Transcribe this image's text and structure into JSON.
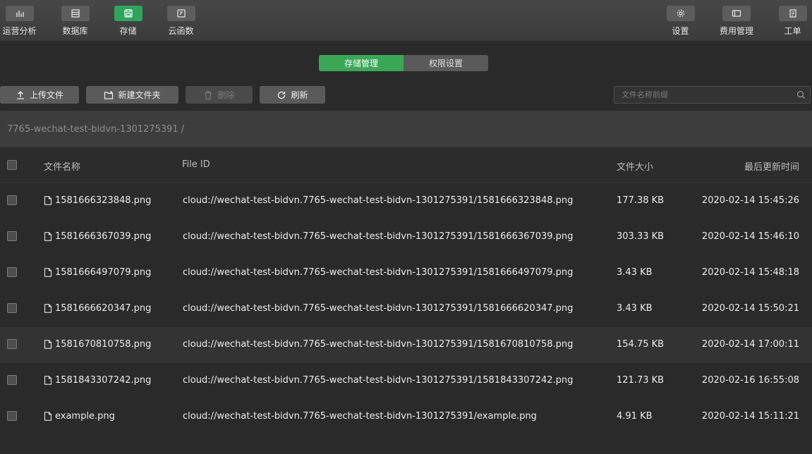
{
  "nav": {
    "left": [
      {
        "label": "运营分析",
        "icon": "bar-chart-icon"
      },
      {
        "label": "数据库",
        "icon": "database-icon"
      },
      {
        "label": "存储",
        "icon": "storage-icon",
        "active": true
      },
      {
        "label": "云函数",
        "icon": "cloud-function-icon"
      }
    ],
    "right": [
      {
        "label": "设置",
        "icon": "gear-icon"
      },
      {
        "label": "费用管理",
        "icon": "billing-icon"
      },
      {
        "label": "工单",
        "icon": "ticket-icon"
      }
    ]
  },
  "tabs": [
    {
      "label": "存储管理",
      "active": true
    },
    {
      "label": "权限设置",
      "active": false
    }
  ],
  "toolbar": {
    "upload": "上传文件",
    "new_folder": "新建文件夹",
    "delete": "删除",
    "refresh": "刷新"
  },
  "search": {
    "placeholder": "文件名称前缀",
    "value": ""
  },
  "path": "7765-wechat-test-bidvn-1301275391 /",
  "table": {
    "columns": [
      "文件名称",
      "File ID",
      "文件大小",
      "最后更新时间"
    ],
    "rows": [
      {
        "name": "1581666323848.png",
        "file_id": "cloud://wechat-test-bidvn.7765-wechat-test-bidvn-1301275391/1581666323848.png",
        "size": "177.38 KB",
        "updated": "2020-02-14 15:45:26"
      },
      {
        "name": "1581666367039.png",
        "file_id": "cloud://wechat-test-bidvn.7765-wechat-test-bidvn-1301275391/1581666367039.png",
        "size": "303.33 KB",
        "updated": "2020-02-14 15:46:10"
      },
      {
        "name": "1581666497079.png",
        "file_id": "cloud://wechat-test-bidvn.7765-wechat-test-bidvn-1301275391/1581666497079.png",
        "size": "3.43 KB",
        "updated": "2020-02-14 15:48:18"
      },
      {
        "name": "1581666620347.png",
        "file_id": "cloud://wechat-test-bidvn.7765-wechat-test-bidvn-1301275391/1581666620347.png",
        "size": "3.43 KB",
        "updated": "2020-02-14 15:50:21"
      },
      {
        "name": "1581670810758.png",
        "file_id": "cloud://wechat-test-bidvn.7765-wechat-test-bidvn-1301275391/1581670810758.png",
        "size": "154.75 KB",
        "updated": "2020-02-14 17:00:11"
      },
      {
        "name": "1581843307242.png",
        "file_id": "cloud://wechat-test-bidvn.7765-wechat-test-bidvn-1301275391/1581843307242.png",
        "size": "121.73 KB",
        "updated": "2020-02-16 16:55:08"
      },
      {
        "name": "example.png",
        "file_id": "cloud://wechat-test-bidvn.7765-wechat-test-bidvn-1301275391/example.png",
        "size": "4.91 KB",
        "updated": "2020-02-14 15:11:21"
      }
    ]
  },
  "colors": {
    "accent": "#3aa757",
    "background": "#2a2a2a"
  }
}
